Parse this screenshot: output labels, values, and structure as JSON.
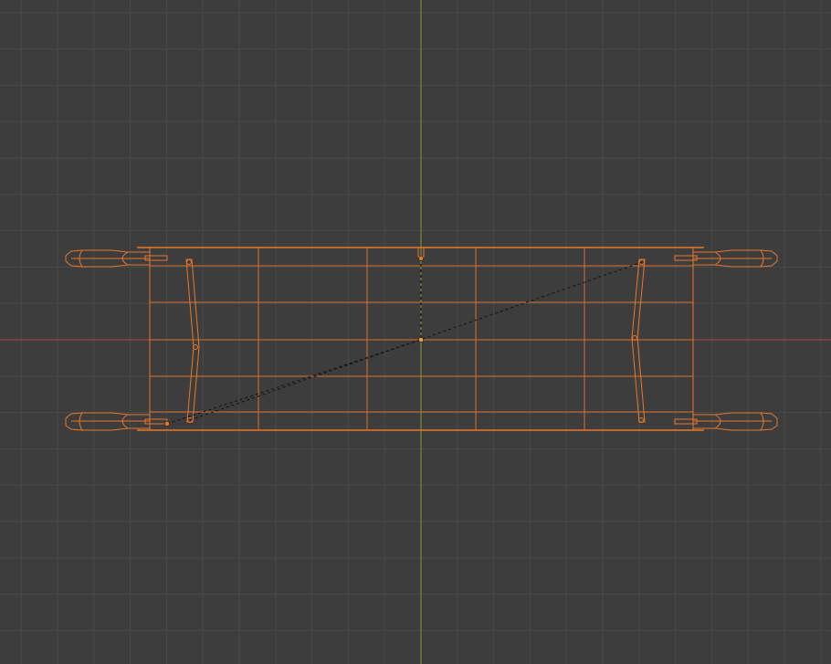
{
  "viewport": {
    "view": "top-orthographic",
    "grid": true,
    "colors": {
      "background": "#3d3d3d",
      "grid_line": "#4a4a4a",
      "x_axis": "#a8474d",
      "y_axis": "#7e9a2a",
      "selection": "#e8782a",
      "selection_dim": "#c8682a",
      "relationship_line": "#111111"
    }
  },
  "scene": {
    "object_type": "stretcher",
    "selected": true
  }
}
